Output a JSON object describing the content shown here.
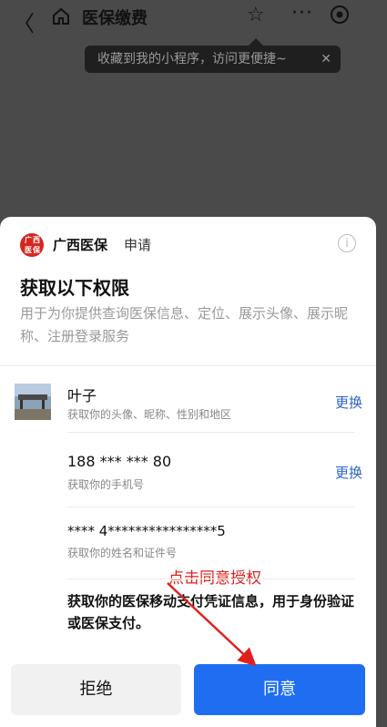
{
  "header": {
    "title": "医保缴费",
    "back_glyph": "〈",
    "more_glyph": "···"
  },
  "tooltip": {
    "text": "收藏到我的小程序，访问更便捷~",
    "close_glyph": "✕"
  },
  "sheet": {
    "app_name": "广西医保",
    "apply_label": "申请",
    "logo_text": "广西医保",
    "info_glyph": "i",
    "title": "获取以下权限",
    "description": "用于为你提供查询医保信息、定位、展示头像、展示昵称、注册登录服务",
    "items": [
      {
        "name": "叶子",
        "sub": "获取你的头像、昵称、性别和地区",
        "action": "更换"
      },
      {
        "name": "188 *** *** 80",
        "sub": "获取你的手机号",
        "action": "更换"
      },
      {
        "name": "**** 4****************5",
        "sub": "获取你的姓名和证件号"
      }
    ],
    "annotation": "点击同意授权",
    "payment_note": "获取你的医保移动支付凭证信息，用于身份验证或医保支付。",
    "reject_label": "拒绝",
    "agree_label": "同意"
  },
  "colors": {
    "accent": "#1f6ef2",
    "link": "#2b64c8",
    "annotation": "#e02020",
    "logo": "#d7261e"
  },
  "icons": [
    "back-icon",
    "home-icon",
    "star-icon",
    "more-icon",
    "target-icon",
    "close-icon",
    "info-icon",
    "arrow-icon"
  ]
}
